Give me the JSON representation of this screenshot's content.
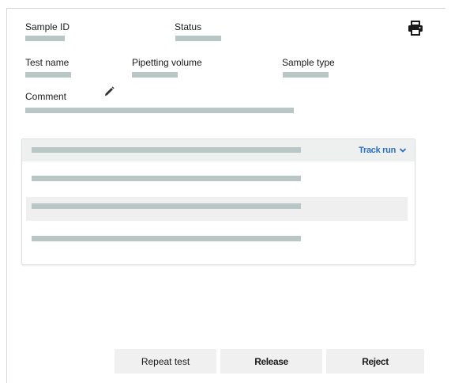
{
  "header": {
    "sample_id_label": "Sample ID",
    "status_label": "Status",
    "test_name_label": "Test name",
    "pipetting_volume_label": "Pipetting volume",
    "sample_type_label": "Sample type",
    "comment_label": "Comment"
  },
  "icons": {
    "print": "printer-icon",
    "edit_comment": "pencil-icon",
    "track_run_chevron": "chevron-down-icon"
  },
  "card": {
    "track_run_label": "Track run"
  },
  "buttons": {
    "repeat_label": "Repeat test",
    "release_label": "Release",
    "reject_label": "Reject"
  },
  "colors": {
    "accent": "#2a6fc0",
    "placeholder": "#b8c6c6",
    "button_bg": "#f0f0f0"
  }
}
